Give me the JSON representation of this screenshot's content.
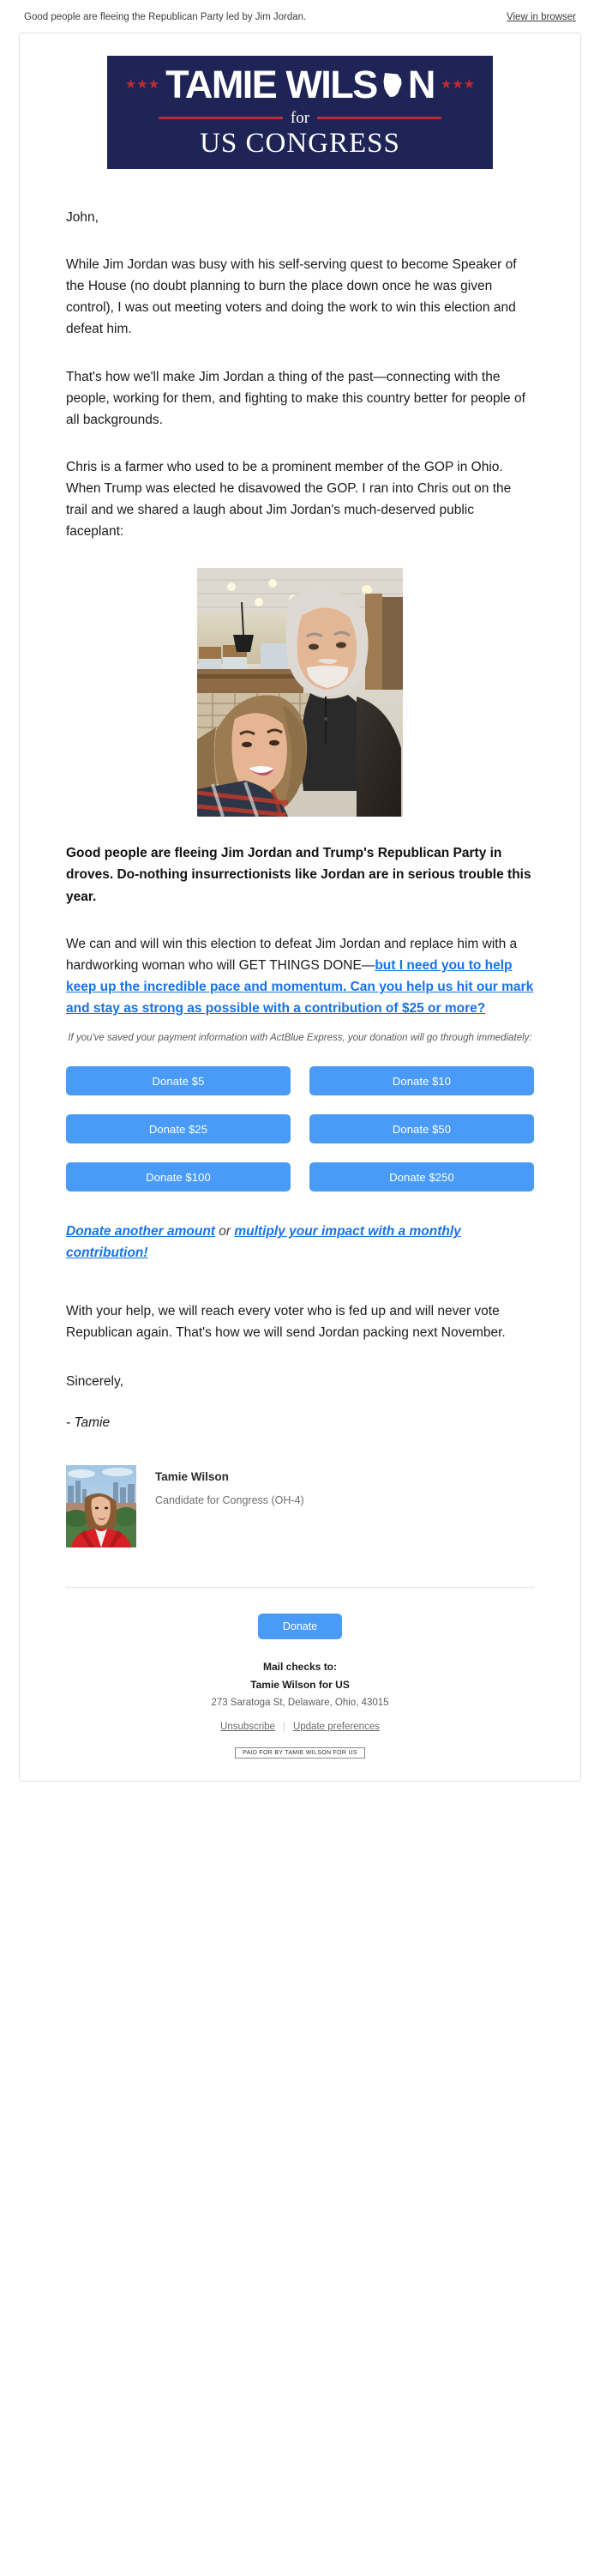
{
  "preheader": {
    "subject": "Good people are fleeing the Republican Party led by Jim Jordan.",
    "view_in_browser": "View in browser"
  },
  "banner": {
    "name_part1": "TAMIE WILS",
    "name_part2": "N",
    "ohio_icon": "ohio-state-shape-icon",
    "for_word": "for",
    "office": "US CONGRESS",
    "stars_left": "★★★",
    "stars_right": "★★★",
    "navy": "#1f2456",
    "red": "#bd2c31"
  },
  "letter": {
    "salutation": "John,",
    "paragraph_1": "While Jim Jordan was busy with his self-serving quest to become Speaker of the House (no doubt planning to burn the place down once he was given control), I was out meeting voters and doing the work to win this election and defeat him.",
    "paragraph_2": "That's how we'll make Jim Jordan a thing of the past—connecting with the people, working for them, and fighting to make this country better for people of all backgrounds.",
    "paragraph_3": "Chris is a farmer who used to be a prominent member of the GOP in Ohio. When Trump was elected he disavowed the GOP. I ran into Chris out on the trail and we shared a laugh about Jim Jordan's much-deserved public faceplant:",
    "photo_alt": "selfie-photo-tamie-and-chris",
    "bold_paragraph": "Good people are fleeing Jim Jordan and Trump's Republican Party in droves. Do-nothing insurrectionists like Jordan are in serious trouble this year.",
    "ask_prefix": "We can and will win this election to defeat Jim Jordan and replace him with a hardworking woman who will GET THINGS DONE—",
    "ask_link": "but I need you to help keep up the incredible pace and momentum. Can you help us hit our mark and stay as strong as possible with a contribution of $25 or more?",
    "actblue_note": "If you've saved your payment information with ActBlue Express, your donation will go through immediately:",
    "other_amount_link": "Donate another amount",
    "or_word": "or",
    "monthly_link": "multiply your impact with a monthly contribution!",
    "closing_paragraph": "With your help, we will reach every voter who is fed up and will never vote Republican again. That's how we will send Jordan packing next November.",
    "sign_off": "Sincerely,",
    "signature": "- Tamie"
  },
  "donate_buttons": [
    {
      "label": "Donate $5",
      "amount": 5
    },
    {
      "label": "Donate $10",
      "amount": 10
    },
    {
      "label": "Donate $25",
      "amount": 25
    },
    {
      "label": "Donate $50",
      "amount": 50
    },
    {
      "label": "Donate $100",
      "amount": 100
    },
    {
      "label": "Donate $250",
      "amount": 250
    }
  ],
  "signature_card": {
    "photo_alt": "headshot-tamie-wilson",
    "name": "Tamie Wilson",
    "role": "Candidate for Congress (OH-4)"
  },
  "footer": {
    "donate_label": "Donate",
    "mail_checks_label": "Mail checks to:",
    "committee": "Tamie Wilson for US",
    "address": "273 Saratoga St, Delaware, Ohio, 43015",
    "unsubscribe": "Unsubscribe",
    "separator": "|",
    "update_preferences": "Update preferences",
    "disclaimer": "PAID FOR BY TAMIE WILSON FOR US"
  },
  "colors": {
    "donate_blue": "#4a9bf7",
    "link_blue": "#1673e6",
    "banner_navy": "#1f2456"
  }
}
